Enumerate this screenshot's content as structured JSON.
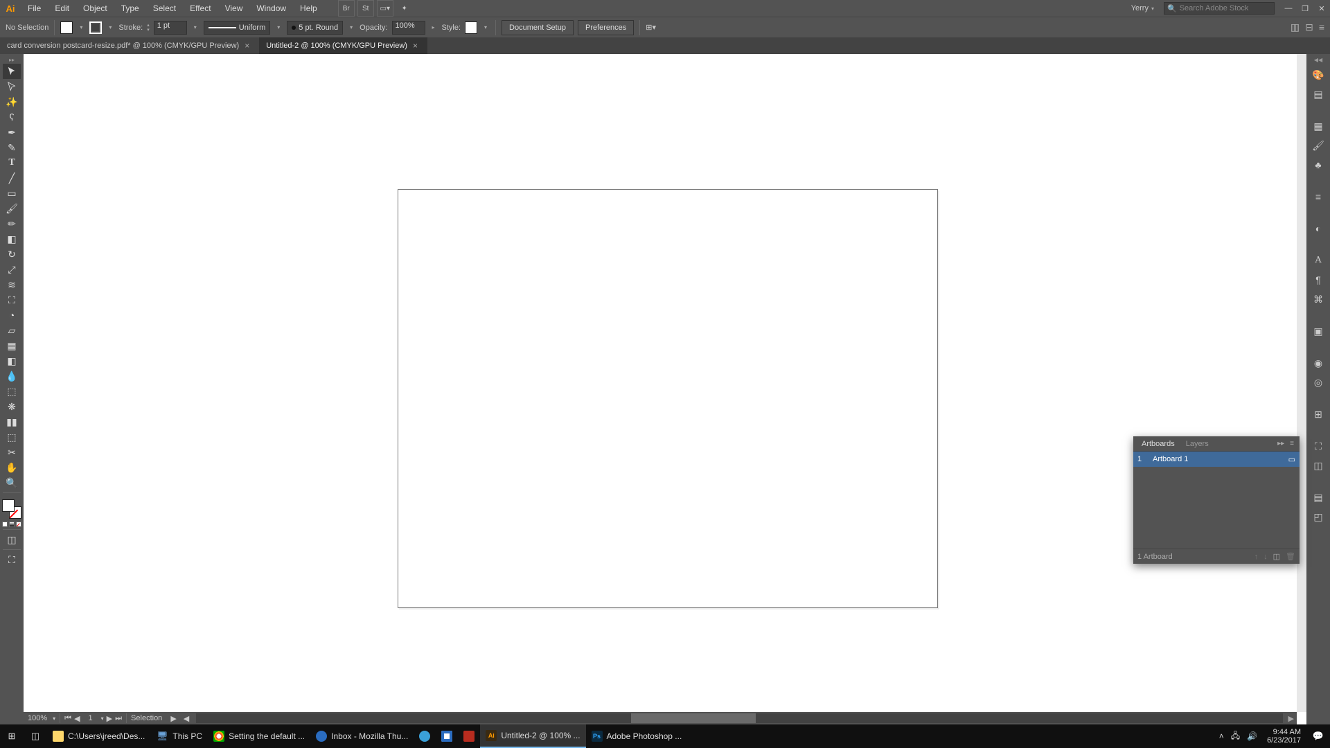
{
  "app": {
    "icon_label": "Ai"
  },
  "menu": [
    "File",
    "Edit",
    "Object",
    "Type",
    "Select",
    "Effect",
    "View",
    "Window",
    "Help"
  ],
  "menubar_buttons": [
    "Br",
    "St"
  ],
  "workspace_user": "Yerry",
  "search_placeholder": "Search Adobe Stock",
  "control": {
    "selection_state": "No Selection",
    "stroke_label": "Stroke:",
    "stroke_weight": "1 pt",
    "stroke_profile": "Uniform",
    "brush": "5 pt. Round",
    "opacity_label": "Opacity:",
    "opacity_value": "100%",
    "style_label": "Style:",
    "doc_setup": "Document Setup",
    "preferences": "Preferences"
  },
  "tabs": [
    {
      "label": "card conversion postcard-resize.pdf* @ 100% (CMYK/GPU Preview)",
      "active": false
    },
    {
      "label": "Untitled-2 @ 100% (CMYK/GPU Preview)",
      "active": true
    }
  ],
  "tools": [
    "selection",
    "direct-selection",
    "magic-wand",
    "lasso",
    "pen",
    "curvature",
    "type",
    "line",
    "rectangle",
    "paintbrush",
    "pencil",
    "eraser",
    "rotate",
    "scale",
    "width",
    "free-transform",
    "shape-builder",
    "perspective",
    "mesh",
    "gradient",
    "eyedropper",
    "blend",
    "symbol-sprayer",
    "column-graph",
    "artboard",
    "slice",
    "hand",
    "zoom"
  ],
  "right_icons": [
    "color",
    "color-guide",
    "swatches",
    "brushes",
    "symbols",
    "stroke",
    "gradient",
    "transparency",
    "appearance",
    "graphic-styles",
    "layers",
    "artboards",
    "align",
    "transform",
    "pathfinder",
    "info",
    "navigator",
    "libraries"
  ],
  "statusbar": {
    "zoom": "100%",
    "artboard_index": "1",
    "tool": "Selection"
  },
  "artboards_panel": {
    "tab_artboards": "Artboards",
    "tab_layers": "Layers",
    "row": {
      "index": "1",
      "name": "Artboard 1"
    },
    "footer": "1 Artboard"
  },
  "taskbar": {
    "items": [
      {
        "icon": "folder",
        "label": "C:\\Users\\jreed\\Des...",
        "color": "#ffd86b"
      },
      {
        "icon": "pc",
        "label": "This PC",
        "color": "#6aa2d8"
      },
      {
        "icon": "chrome",
        "label": "Setting the default ...",
        "color": "#fff"
      },
      {
        "icon": "thunderbird",
        "label": "Inbox - Mozilla Thu...",
        "color": "#2a6cc0"
      },
      {
        "icon": "app",
        "label": "",
        "color": "#3aa0d8"
      },
      {
        "icon": "shield",
        "label": "",
        "color": "#2a6cc0"
      },
      {
        "icon": "pdf",
        "label": "",
        "color": "#b82c1f"
      },
      {
        "icon": "ai",
        "label": "Untitled-2 @ 100% ...",
        "color": "#ff9a00",
        "active": true
      },
      {
        "icon": "ps",
        "label": "Adobe Photoshop ...",
        "color": "#31a8ff"
      }
    ],
    "time": "9:44 AM",
    "date": "6/23/2017"
  }
}
